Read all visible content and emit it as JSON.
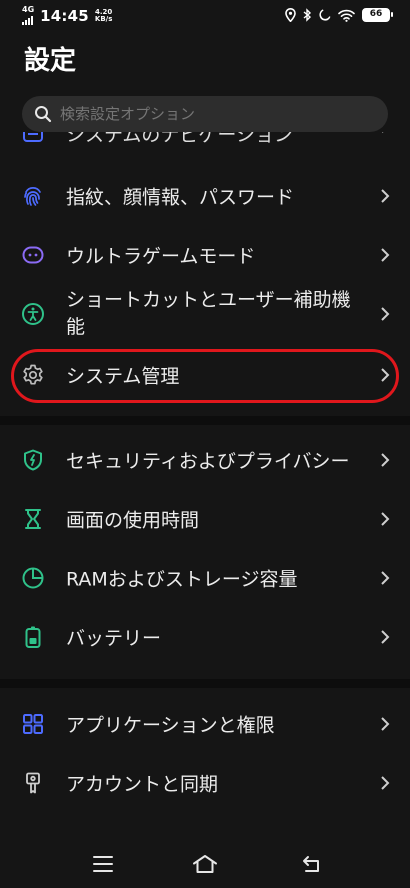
{
  "status_bar": {
    "network": "4G",
    "time": "14:45",
    "speed_value": "4.20",
    "speed_unit": "KB/s",
    "battery": "66",
    "icons": [
      "location-icon",
      "bluetooth-icon",
      "moon-icon",
      "wifi-icon",
      "battery-icon"
    ]
  },
  "page": {
    "title": "設定"
  },
  "search": {
    "placeholder": "検索設定オプション",
    "icon": "search-icon"
  },
  "colors": {
    "accent_green": "#2fc28a",
    "accent_blue": "#4d6bff",
    "accent_purple": "#8b6bf5",
    "highlight": "#e0171c"
  },
  "settings": {
    "partial_item": {
      "label": "システムのナビゲーション"
    },
    "items": [
      {
        "label": "指紋、顔情報、パスワード",
        "icon": "fingerprint-icon"
      },
      {
        "label": "ウルトラゲームモード",
        "icon": "game-controller-icon"
      },
      {
        "label": "ショートカットとユーザー補助機能",
        "icon": "accessibility-icon"
      },
      {
        "label": "システム管理",
        "icon": "gear-icon"
      },
      {
        "label": "セキュリティおよびプライバシー",
        "icon": "shield-icon"
      },
      {
        "label": "画面の使用時間",
        "icon": "hourglass-icon"
      },
      {
        "label": "RAMおよびストレージ容量",
        "icon": "pie-chart-icon"
      },
      {
        "label": "バッテリー",
        "icon": "battery-icon"
      },
      {
        "label": "アプリケーションと権限",
        "icon": "apps-grid-icon"
      },
      {
        "label": "アカウントと同期",
        "icon": "account-key-icon"
      }
    ]
  },
  "nav_bar": {
    "icons": [
      "menu-icon",
      "home-icon",
      "back-icon"
    ]
  }
}
